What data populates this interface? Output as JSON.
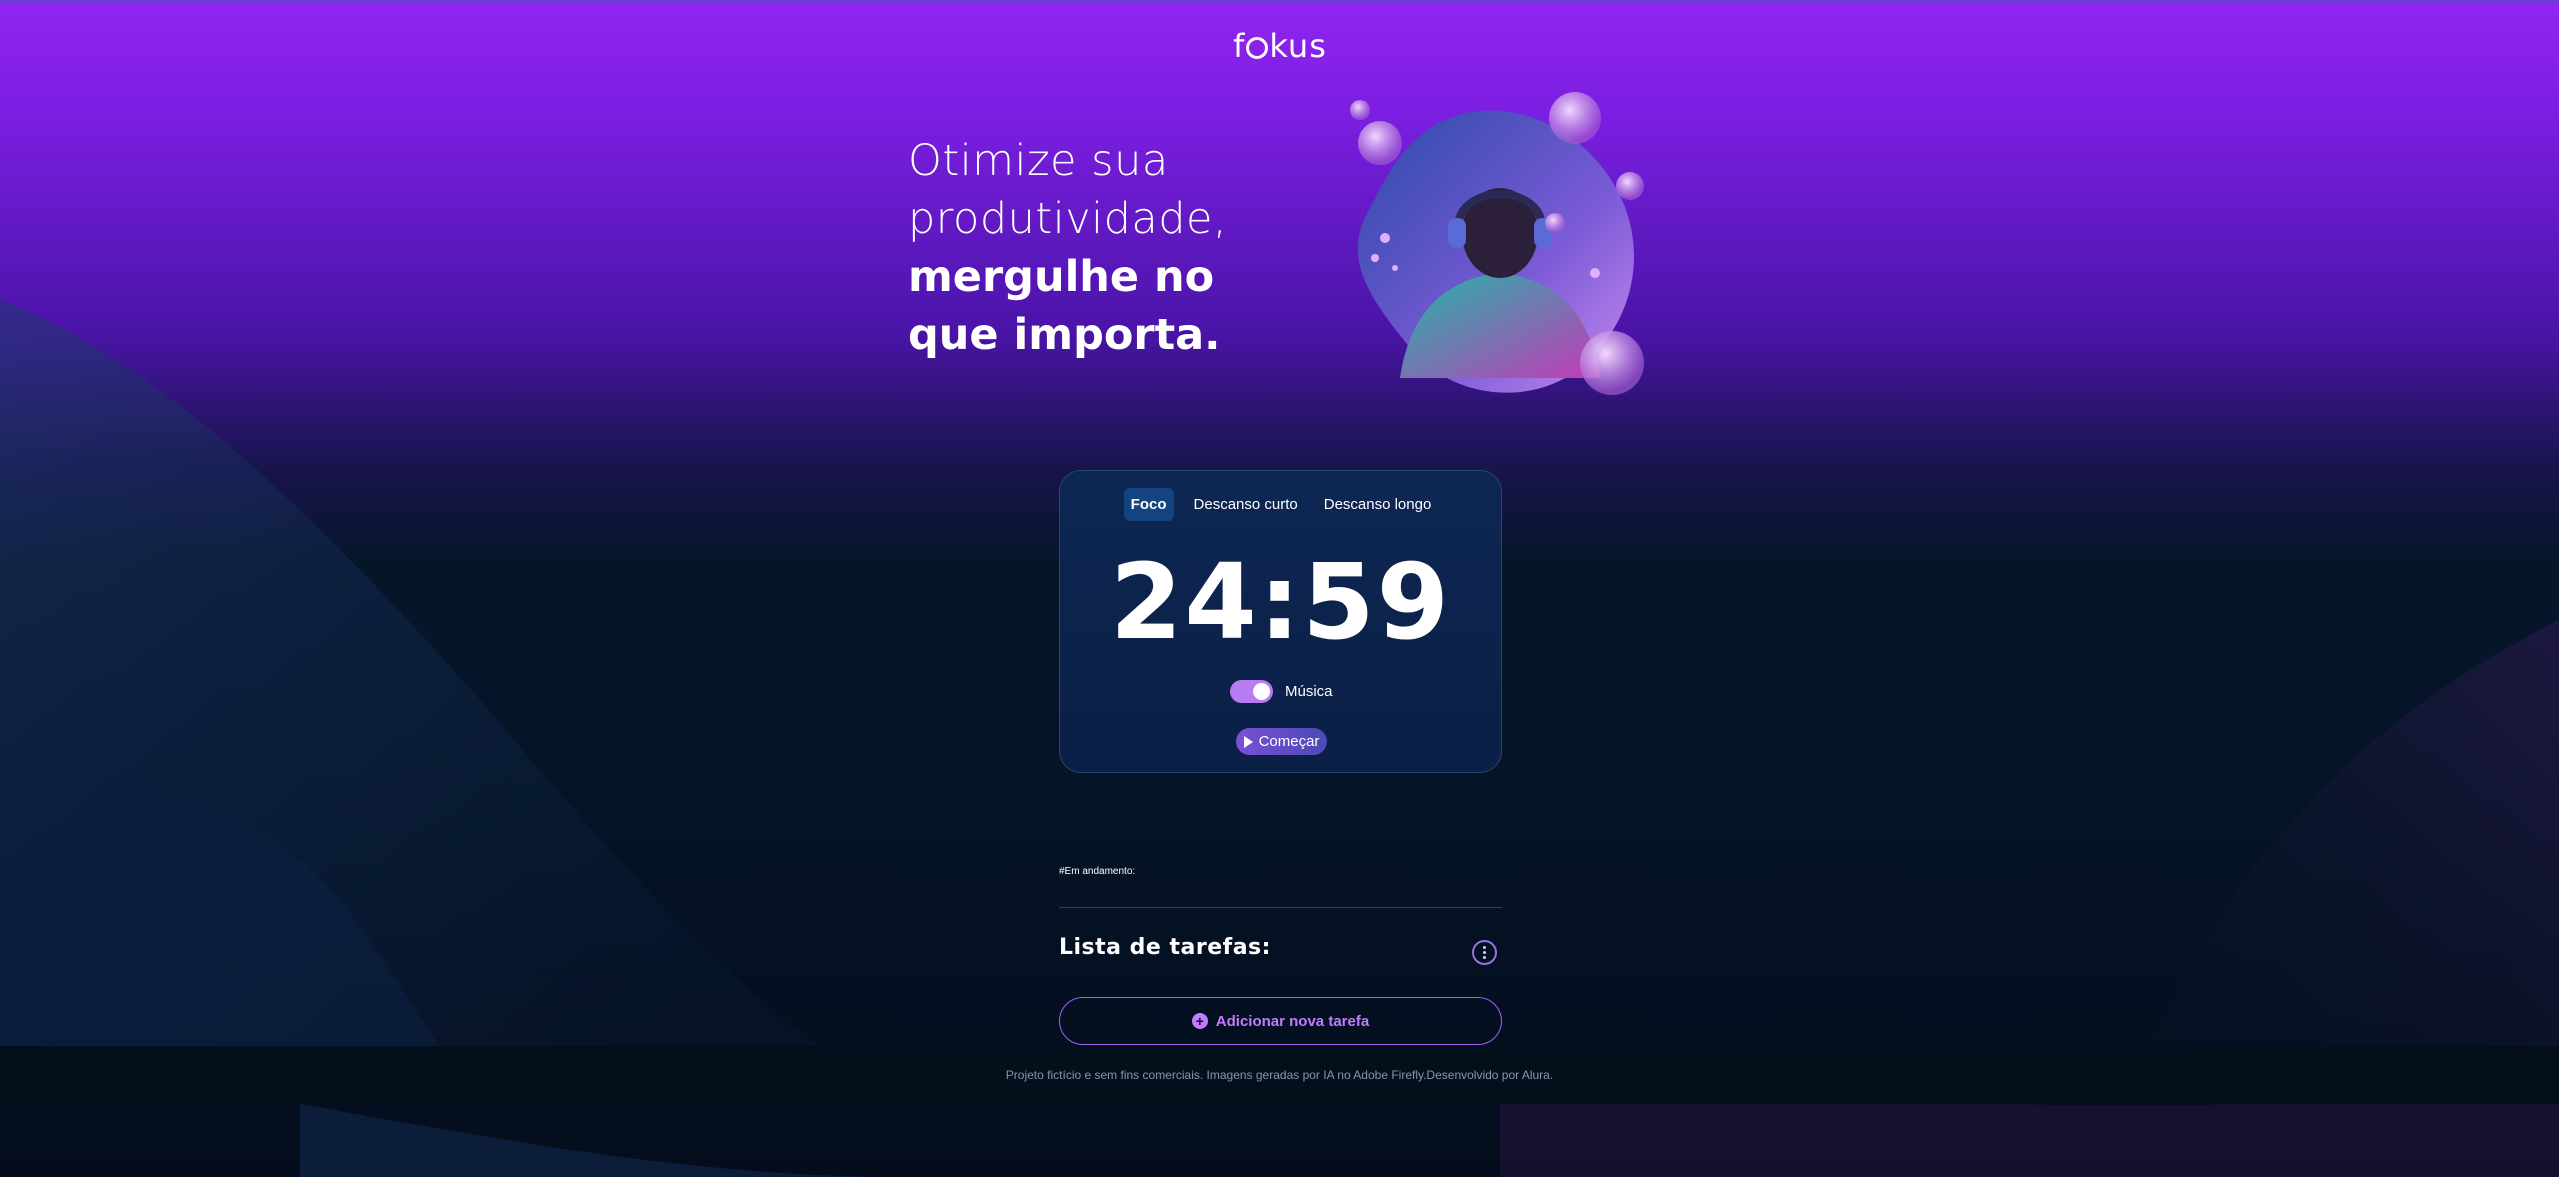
{
  "brand": {
    "logo_text": "fokus"
  },
  "headline": {
    "line1": "Otimize sua",
    "line2": "produtividade,",
    "line3": "mergulhe no",
    "line4": "que importa."
  },
  "timer_card": {
    "tabs": [
      {
        "label": "Foco",
        "active": true
      },
      {
        "label": "Descanso curto",
        "active": false
      },
      {
        "label": "Descanso longo",
        "active": false
      }
    ],
    "time": "24:59",
    "music_label": "Música",
    "music_on": true,
    "start_label": "Começar"
  },
  "tasks": {
    "in_progress_label": "#Em andamento:",
    "title": "Lista de tarefas:",
    "add_label": "Adicionar nova tarefa"
  },
  "footer": {
    "text": "Projeto fictício e sem fins comerciais. Imagens geradas por IA no Adobe Firefly.Desenvolvido por Alura."
  },
  "colors": {
    "accent": "#c07cff",
    "header_purple": "#9224f2",
    "card_bg": "#0d2753",
    "active_tab": "#144480"
  },
  "icons": [
    "play-icon",
    "plus-circle-icon",
    "more-vertical-icon"
  ]
}
